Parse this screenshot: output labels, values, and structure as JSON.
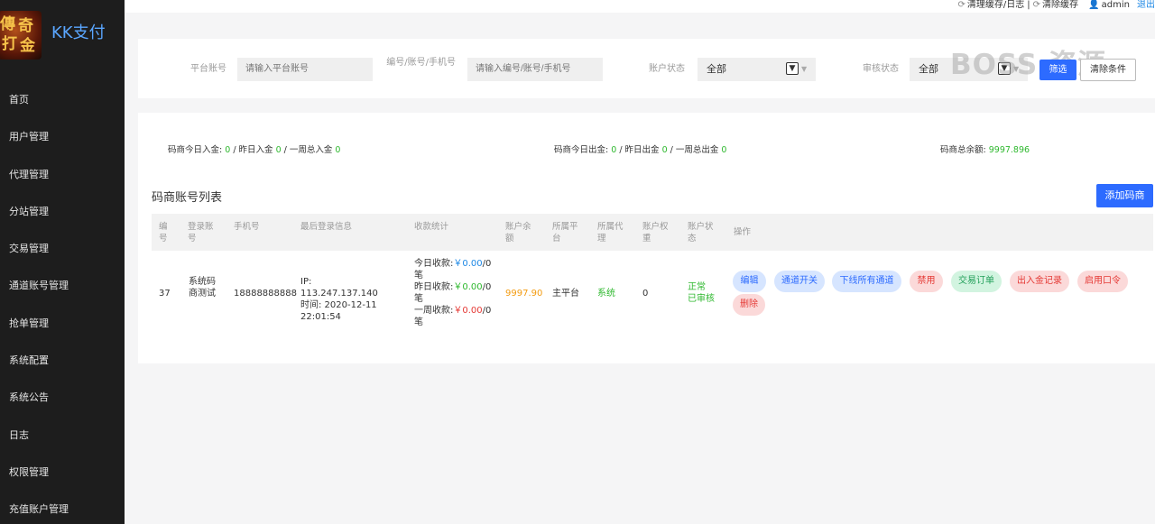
{
  "app": {
    "title": "KK支付"
  },
  "sidebar": {
    "items": [
      {
        "label": "首页"
      },
      {
        "label": "用户管理"
      },
      {
        "label": "代理管理"
      },
      {
        "label": "分站管理"
      },
      {
        "label": "交易管理"
      },
      {
        "label": "通道账号管理"
      },
      {
        "label": "抢单管理"
      },
      {
        "label": "系统配置"
      },
      {
        "label": "系统公告"
      },
      {
        "label": "日志"
      },
      {
        "label": "权限管理"
      },
      {
        "label": "充值账户管理"
      }
    ]
  },
  "topbar": {
    "clear_cache_log": "清理缓存/日志",
    "separator": "|",
    "clear_cache": "清除缓存",
    "user": "admin",
    "logout": "退出"
  },
  "filter": {
    "platform_account_label": "平台账号",
    "platform_account_placeholder": "请输入平台账号",
    "search_label": "编号/账号/手机号",
    "search_placeholder": "请输入编号/账号/手机号",
    "account_status_label": "账户状态",
    "account_status_value": "全部",
    "audit_status_label": "审核状态",
    "audit_status_value": "全部",
    "filter_button": "筛选",
    "clear_button": "清除条件"
  },
  "watermark": "BOSS 资源",
  "stats": {
    "deposit_label_today": "码商今日入金:",
    "deposit_today": "0",
    "deposit_label_yesterday": "/ 昨日入金",
    "deposit_yesterday": "0",
    "deposit_label_week": "/ 一周总入金",
    "deposit_week": "0",
    "withdraw_label_today": "码商今日出金:",
    "withdraw_today": "0",
    "withdraw_label_yesterday": "/ 昨日出金",
    "withdraw_yesterday": "0",
    "withdraw_label_week": "/ 一周总出金",
    "withdraw_week": "0",
    "balance_label": "码商总余额:",
    "balance": "9997.896"
  },
  "list": {
    "title": "码商账号列表",
    "add_button": "添加码商",
    "columns": [
      "编号",
      "登录账号",
      "手机号",
      "最后登录信息",
      "收款统计",
      "账户余额",
      "所属平台",
      "所属代理",
      "账户权重",
      "账户状态",
      "操作"
    ],
    "rows": [
      {
        "id": "37",
        "account": "系统码商测试",
        "phone": "18888888888",
        "login_ip": "IP: 113.247.137.140",
        "login_time": "时间: 2020-12-11 22:01:54",
        "stat_today_label": "今日收款:",
        "stat_today_amount": "￥0.00",
        "stat_today_count": "/0笔",
        "stat_yesterday_label": "昨日收款:",
        "stat_yesterday_amount": "￥0.00",
        "stat_yesterday_count": "/0笔",
        "stat_week_label": "一周收款:",
        "stat_week_amount": "￥0.00",
        "stat_week_count": "/0笔",
        "balance": "9997.90",
        "platform": "主平台",
        "agent": "系统",
        "weight": "0",
        "status_normal": "正常",
        "status_audit": "已审核",
        "actions": {
          "edit": "编辑",
          "channel_switch": "通道开关",
          "offline_all": "下线所有通道",
          "disable": "禁用",
          "orders": "交易订单",
          "fund_records": "出入金记录",
          "enable_password": "启用口令",
          "delete": "删除"
        }
      }
    ]
  },
  "colors": {
    "sidebar_bg": "#1d1d1d",
    "primary": "#2d6bff",
    "success": "#2eb82e",
    "danger": "#e53935",
    "warning": "#f39c12",
    "link": "#1e88e5"
  },
  "icons": {
    "refresh": "refresh-icon",
    "user": "user-icon",
    "dropdown": "chevron-down-icon"
  }
}
